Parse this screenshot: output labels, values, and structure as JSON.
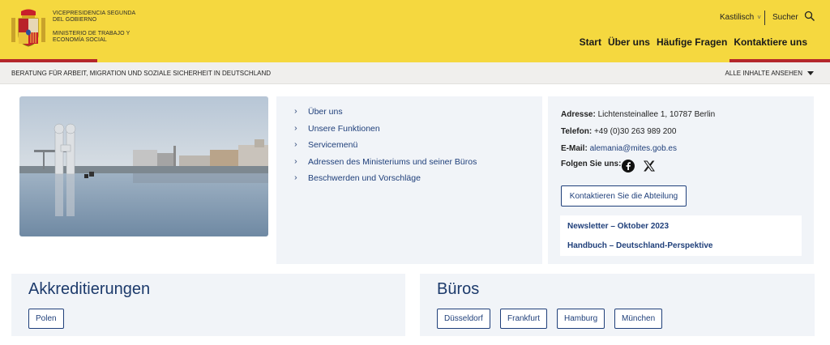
{
  "header": {
    "org_line1": "VICEPRESIDENCIA SEGUNDA DEL GOBIERNO",
    "org_line2": "MINISTERIO DE TRABAJO Y ECONOMÍA SOCIAL",
    "language": "Kastilisch",
    "search_label": "Sucher",
    "nav": [
      "Start",
      "Über uns",
      "Häufige Fragen",
      "Kontaktiere uns"
    ],
    "colors": {
      "yellow": "#f5d83f",
      "red": "#b4272b",
      "link": "#1f3f7a"
    }
  },
  "subbar": {
    "section_title": "BERATUNG FÜR ARBEIT, MIGRATION UND SOZIALE SICHERHEIT IN DEUTSCHLAND",
    "all_content": "ALLE INHALTE ANSEHEN"
  },
  "links": [
    "Über uns",
    "Unsere Funktionen",
    "Servicemenü",
    "Adressen des Ministeriums und seiner Büros",
    "Beschwerden und Vorschläge"
  ],
  "contact": {
    "address_label": "Adresse:",
    "address_value": "Lichtensteinallee 1, 10787 Berlin",
    "phone_label": "Telefon:",
    "phone_value": "+49 (0)30 263 989 200",
    "email_label": "E-Mail:",
    "email_value": "alemania@mites.gob.es",
    "follow_label": "Folgen Sie uns:",
    "social_icons": [
      "facebook-icon",
      "x-icon"
    ],
    "contact_button": "Kontaktieren Sie die Abteilung",
    "news": [
      "Newsletter – Oktober 2023",
      "Handbuch – Deutschland-Perspektive"
    ]
  },
  "accreditations": {
    "title": "Akkreditierungen",
    "items": [
      "Polen"
    ]
  },
  "offices": {
    "title": "Büros",
    "items": [
      "Düsseldorf",
      "Frankfurt",
      "Hamburg",
      "München"
    ]
  }
}
